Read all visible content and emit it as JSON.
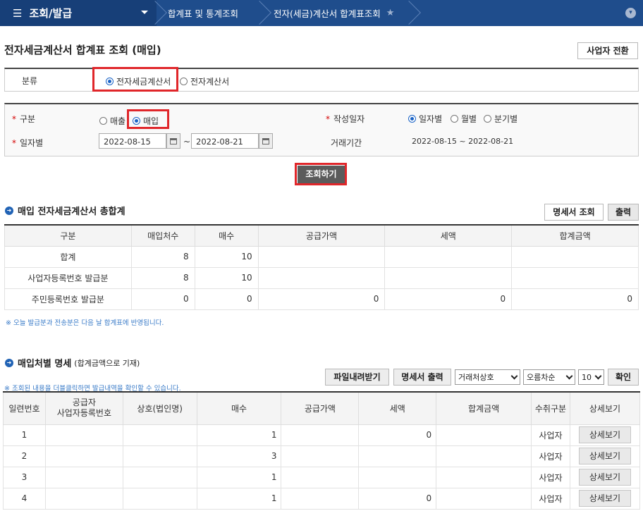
{
  "nav": {
    "menu": "조회/발급",
    "crumbs": [
      "합계표 및 통계조회",
      "전자(세금)계산서 합계표조회"
    ]
  },
  "page": {
    "title": "전자세금계산서 합계표 조회 (매입)",
    "switch_btn": "사업자 전환"
  },
  "category": {
    "label": "분류",
    "options": [
      "전자세금계산서",
      "전자계산서"
    ],
    "selected": "전자세금계산서"
  },
  "search": {
    "type_label": "구분",
    "type_options": [
      "매출",
      "매입"
    ],
    "type_selected": "매입",
    "date_label": "작성일자",
    "date_options": [
      "일자별",
      "월별",
      "분기별"
    ],
    "date_selected": "일자별",
    "daily_label": "일자별",
    "from": "2022-08-15",
    "to": "2022-08-21",
    "tilde": "~",
    "period_label": "거래기간",
    "period_value": "2022-08-15 ~ 2022-08-21",
    "query_btn": "조회하기"
  },
  "summary": {
    "title": "매입 전자세금계산서 총합계",
    "btn_detail": "명세서 조회",
    "btn_print": "출력",
    "headers": [
      "구분",
      "매입처수",
      "매수",
      "공급가액",
      "세액",
      "합계금액"
    ],
    "rows": [
      [
        "합계",
        "8",
        "10",
        "",
        "",
        ""
      ],
      [
        "사업자등록번호 발급분",
        "8",
        "10",
        "",
        "",
        ""
      ],
      [
        "주민등록번호 발급분",
        "0",
        "0",
        "0",
        "0",
        "0"
      ]
    ],
    "note": "※ 오늘 발급분과 전송분은 다음 날 합계표에 반영됩니다."
  },
  "detail": {
    "title": "매입처별 명세",
    "subtitle": "(합계금액으로 기재)",
    "btn_download": "파일내려받기",
    "btn_print": "명세서 출력",
    "sort_field": "거래처상호",
    "sort_order": "오름차순",
    "page_size": "10",
    "confirm": "확인",
    "note": "※ 조회된 내용을 더블클릭하면 발급내역을 확인할 수 있습니다.",
    "headers": [
      "일련번호",
      "공급자\n사업자등록번호",
      "상호(법인명)",
      "매수",
      "공급가액",
      "세액",
      "합계금액",
      "수취구분",
      "상세보기"
    ],
    "rows": [
      [
        "1",
        "",
        "",
        "1",
        "",
        "0",
        "",
        "사업자",
        "상세보기"
      ],
      [
        "2",
        "",
        "",
        "3",
        "",
        "",
        "",
        "사업자",
        "상세보기"
      ],
      [
        "3",
        "",
        "",
        "1",
        "",
        "",
        "",
        "사업자",
        "상세보기"
      ],
      [
        "4",
        "",
        "",
        "1",
        "",
        "0",
        "",
        "사업자",
        "상세보기"
      ]
    ]
  }
}
